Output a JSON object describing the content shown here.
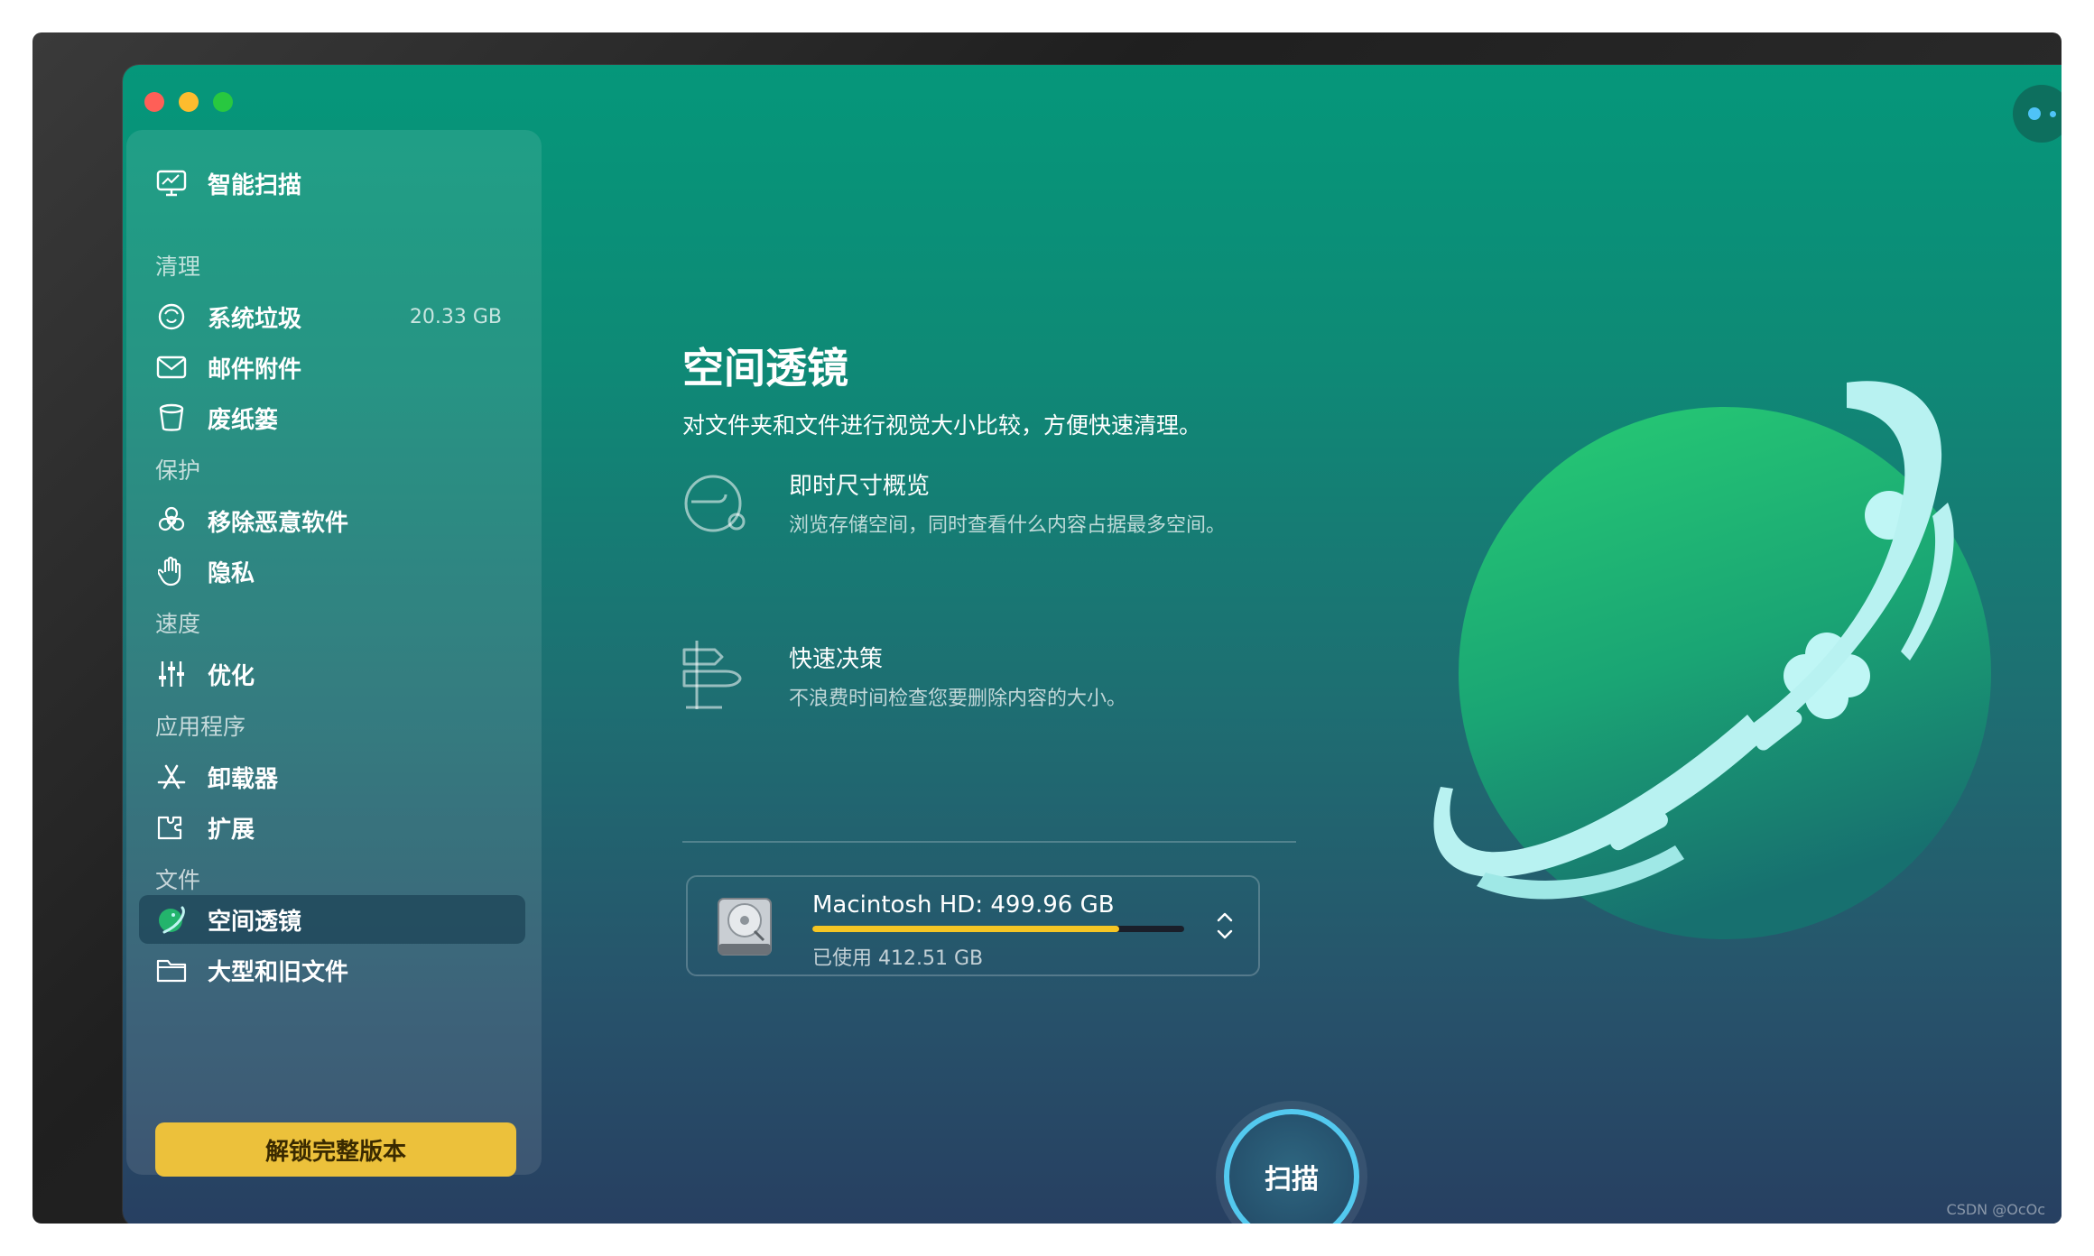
{
  "sidebar": {
    "smart_scan": "智能扫描",
    "sections": {
      "cleanup": "清理",
      "protection": "保护",
      "speed": "速度",
      "apps": "应用程序",
      "files": "文件"
    },
    "items": {
      "system_junk": {
        "label": "系统垃圾",
        "value": "20.33 GB"
      },
      "mail_attachments": {
        "label": "邮件附件"
      },
      "trash": {
        "label": "废纸篓"
      },
      "malware_removal": {
        "label": "移除恶意软件"
      },
      "privacy": {
        "label": "隐私"
      },
      "optimization": {
        "label": "优化"
      },
      "uninstaller": {
        "label": "卸载器"
      },
      "extensions": {
        "label": "扩展"
      },
      "space_lens": {
        "label": "空间透镜"
      },
      "large_old_files": {
        "label": "大型和旧文件"
      }
    },
    "unlock_label": "解锁完整版本"
  },
  "main": {
    "title": "空间透镜",
    "subtitle": "对文件夹和文件进行视觉大小比较，方便快速清理。",
    "features": [
      {
        "title": "即时尺寸概览",
        "desc": "浏览存储空间，同时查看什么内容占据最多空间。"
      },
      {
        "title": "快速决策",
        "desc": "不浪费时间检查您要删除内容的大小。"
      }
    ],
    "disk": {
      "name": "Macintosh HD: 499.96 GB",
      "used": "已使用 412.51 GB",
      "used_fraction": 0.825
    },
    "scan_label": "扫描"
  },
  "colors": {
    "accent_yellow": "#ecc13b",
    "scan_ring": "#53c9ef",
    "planet_green": "#22b46e",
    "ring_cyan": "#a8f0ef"
  },
  "watermark": "CSDN @OcOc"
}
